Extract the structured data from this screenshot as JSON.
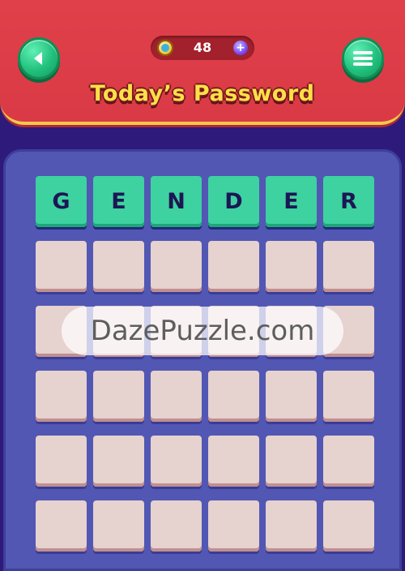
{
  "header": {
    "title": "Today’s Password",
    "coins": "48",
    "back_icon": "arrow-left-icon",
    "menu_icon": "hamburger-menu-icon",
    "coin_icon": "coin-icon",
    "add_icon": "plus-icon"
  },
  "board": {
    "rows": [
      [
        "G",
        "E",
        "N",
        "D",
        "E",
        "R"
      ],
      [
        "",
        "",
        "",
        "",
        "",
        ""
      ],
      [
        "",
        "",
        "",
        "",
        "",
        ""
      ],
      [
        "",
        "",
        "",
        "",
        "",
        ""
      ],
      [
        "",
        "",
        "",
        "",
        "",
        ""
      ],
      [
        "",
        "",
        "",
        "",
        "",
        ""
      ]
    ],
    "row_states": [
      "solved",
      "empty",
      "empty",
      "empty",
      "empty",
      "empty"
    ]
  },
  "watermark": "DazePuzzle.com",
  "colors": {
    "header": "#d93a45",
    "title": "#fde047",
    "board": "#5257b3",
    "tile_correct": "#3dd2a0",
    "tile_empty": "#e6d2cf",
    "button": "#22c07d"
  }
}
